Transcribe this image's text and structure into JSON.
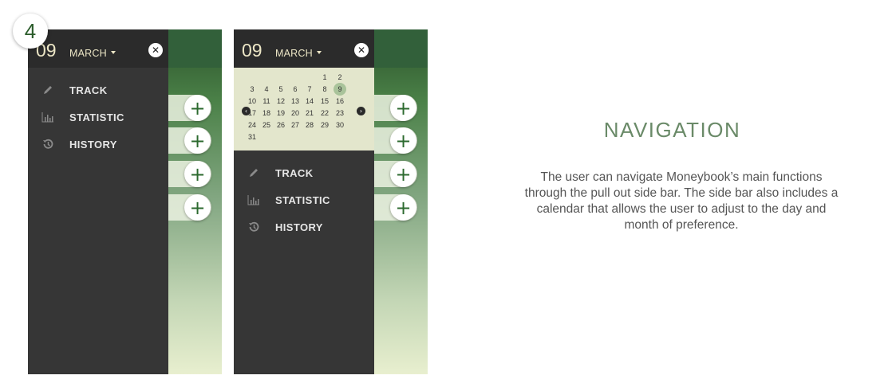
{
  "step_number": "4",
  "colors": {
    "accent_green": "#6a8a68",
    "drawer_bg": "#363636",
    "calendar_bg": "#e3e6cc",
    "selected_day": "#a9c39a"
  },
  "drawer": {
    "day": "09",
    "month": "MARCH",
    "close_icon": "close-icon",
    "menu": [
      {
        "label": "TRACK",
        "icon": "pencil-icon"
      },
      {
        "label": "STATISTIC",
        "icon": "bar-chart-icon"
      },
      {
        "label": "HISTORY",
        "icon": "history-icon"
      }
    ]
  },
  "calendar": {
    "selected": "9",
    "rows": [
      [
        "",
        "",
        "",
        "",
        "",
        "1",
        "2"
      ],
      [
        "3",
        "4",
        "5",
        "6",
        "7",
        "8",
        "9"
      ],
      [
        "10",
        "11",
        "12",
        "13",
        "14",
        "15",
        "16"
      ],
      [
        "17",
        "18",
        "19",
        "20",
        "21",
        "22",
        "23"
      ],
      [
        "24",
        "25",
        "26",
        "27",
        "28",
        "29",
        "30"
      ],
      [
        "31",
        "",
        "",
        "",
        "",
        "",
        ""
      ]
    ]
  },
  "add_buttons": [
    "+",
    "+",
    "+",
    "+"
  ],
  "description": {
    "title": "NAVIGATION",
    "body": "The user can navigate Moneybook’s main functions through the pull out side bar.  The side bar also includes a calendar that allows the user to adjust to the day and month of preference."
  }
}
